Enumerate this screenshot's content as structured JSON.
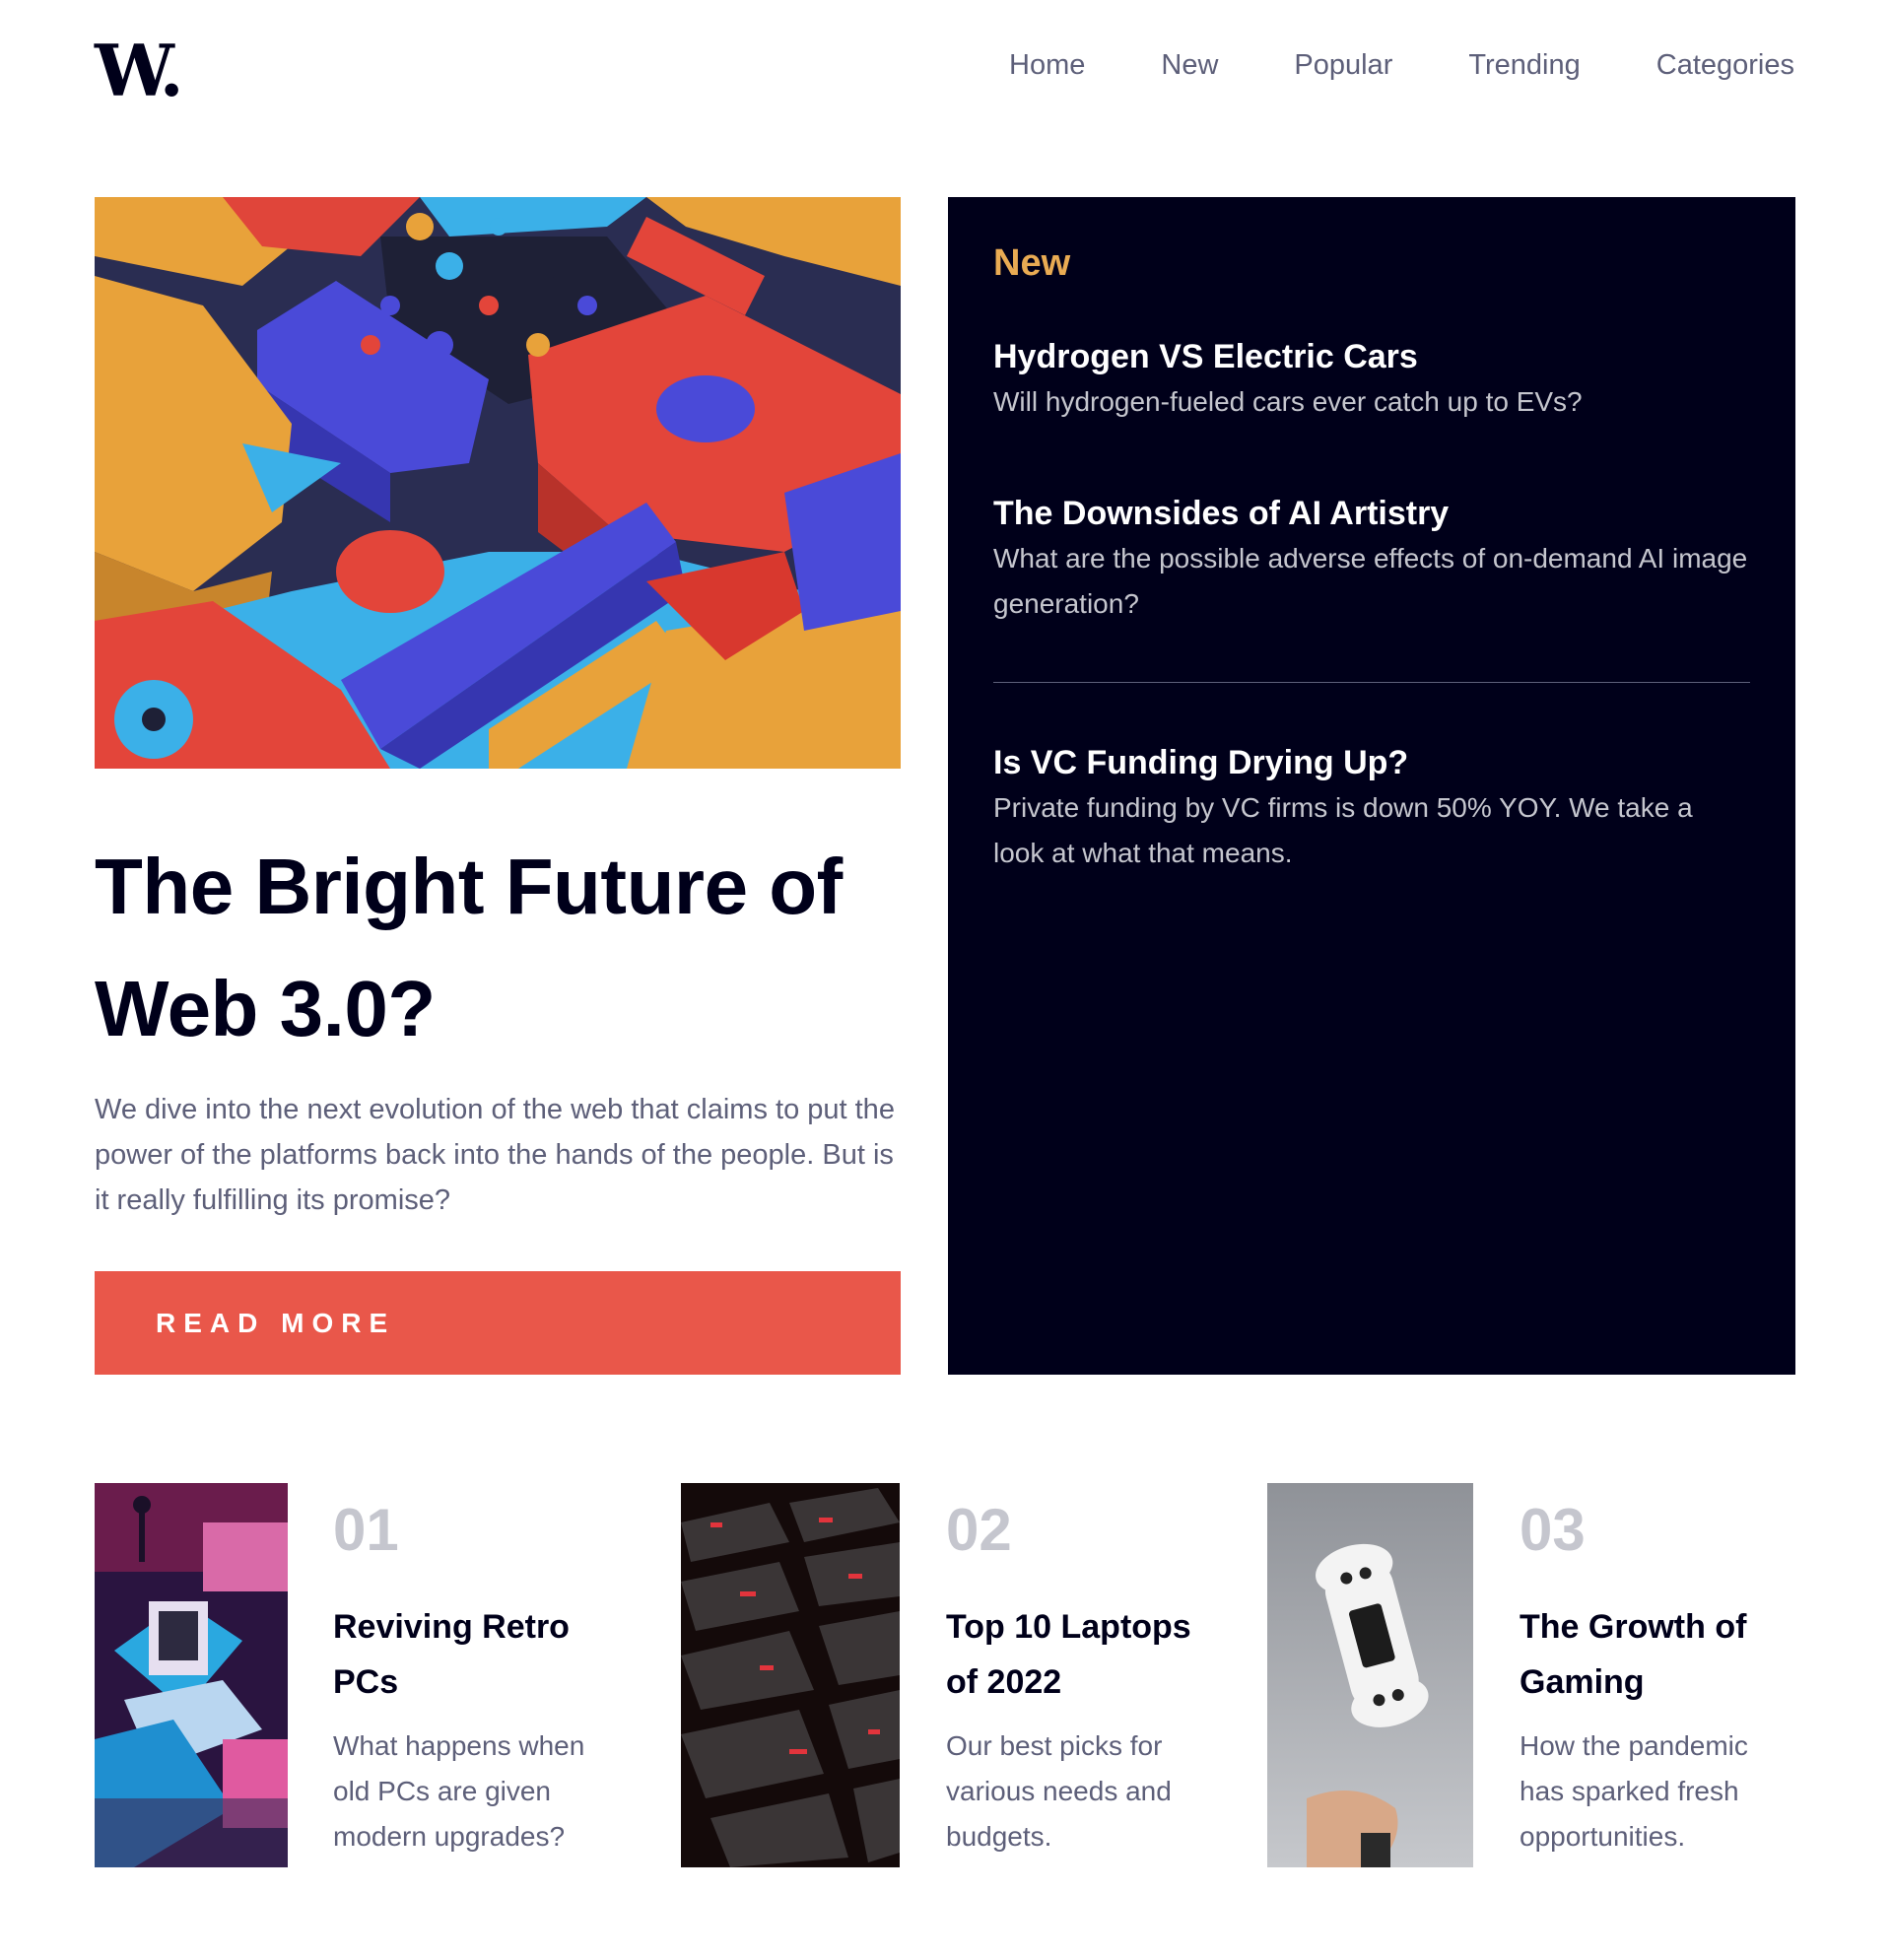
{
  "logo": {
    "text": "W."
  },
  "nav": {
    "items": [
      {
        "label": "Home"
      },
      {
        "label": "New"
      },
      {
        "label": "Popular"
      },
      {
        "label": "Trending"
      },
      {
        "label": "Categories"
      }
    ]
  },
  "hero": {
    "title": "The Bright Future of Web 3.0?",
    "description": "We dive into the next evolution of the web that claims to put the power of the platforms back into the hands of the people. But is it really fulfilling its promise?",
    "button_label": "READ MORE"
  },
  "new_panel": {
    "heading": "New",
    "items": [
      {
        "title": "Hydrogen VS Electric Cars",
        "description": "Will hydrogen-fueled cars ever catch up to EVs?"
      },
      {
        "title": "The Downsides of AI Artistry",
        "description": "What are the possible adverse effects of on-demand AI image generation?"
      },
      {
        "title": "Is VC Funding Drying Up?",
        "description": "Private funding by VC firms is down 50% YOY. We take a look at what that means."
      }
    ]
  },
  "cards": [
    {
      "number": "01",
      "title": "Reviving Retro PCs",
      "description": "What happens when old PCs are given modern upgrades?"
    },
    {
      "number": "02",
      "title": "Top 10 Laptops of 2022",
      "description": "Our best picks for various needs and budgets."
    },
    {
      "number": "03",
      "title": "The Growth of Gaming",
      "description": "How the pandemic has sparked fresh opportunities."
    }
  ],
  "colors": {
    "accent_red": "#e9574a",
    "accent_orange": "#e9ab53",
    "dark_navy": "#00001a",
    "grayish_blue": "#5d5f79",
    "light_gray": "#c5c6ce"
  }
}
